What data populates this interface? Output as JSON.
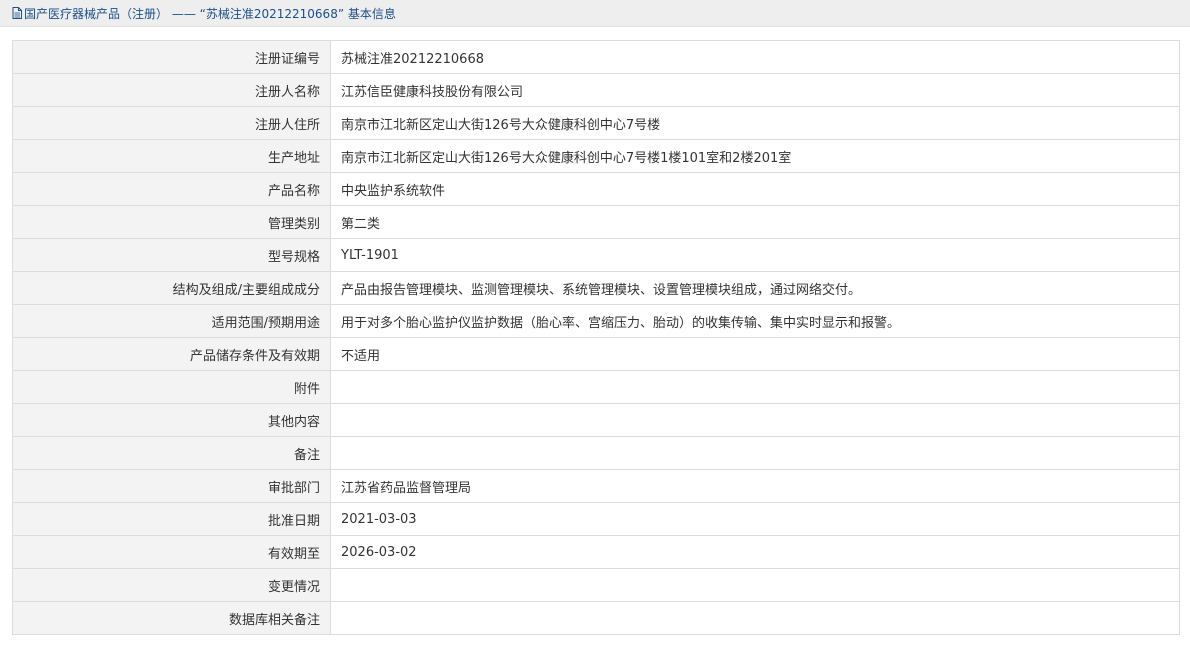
{
  "breadcrumb": {
    "text": "国产医疗器械产品（注册） —— “苏械注准20212210668” 基本信息",
    "icon": "document-icon"
  },
  "colors": {
    "breadcrumb_text": "#1a4f8a",
    "label_bg": "#f3f3f3",
    "border": "#dcdcdc"
  },
  "rows": [
    {
      "label": "注册证编号",
      "value": "苏械注准20212210668"
    },
    {
      "label": "注册人名称",
      "value": "江苏信臣健康科技股份有限公司"
    },
    {
      "label": "注册人住所",
      "value": "南京市江北新区定山大街126号大众健康科创中心7号楼"
    },
    {
      "label": "生产地址",
      "value": "南京市江北新区定山大街126号大众健康科创中心7号楼1楼101室和2楼201室"
    },
    {
      "label": "产品名称",
      "value": "中央监护系统软件"
    },
    {
      "label": "管理类别",
      "value": "第二类"
    },
    {
      "label": "型号规格",
      "value": "YLT-1901"
    },
    {
      "label": "结构及组成/主要组成成分",
      "value": "产品由报告管理模块、监测管理模块、系统管理模块、设置管理模块组成，通过网络交付。"
    },
    {
      "label": "适用范围/预期用途",
      "value": "用于对多个胎心监护仪监护数据（胎心率、宫缩压力、胎动）的收集传输、集中实时显示和报警。"
    },
    {
      "label": "产品储存条件及有效期",
      "value": "不适用"
    },
    {
      "label": "附件",
      "value": ""
    },
    {
      "label": "其他内容",
      "value": ""
    },
    {
      "label": "备注",
      "value": ""
    },
    {
      "label": "审批部门",
      "value": "江苏省药品监督管理局"
    },
    {
      "label": "批准日期",
      "value": "2021-03-03"
    },
    {
      "label": "有效期至",
      "value": "2026-03-02"
    },
    {
      "label": "变更情况",
      "value": ""
    },
    {
      "label": "数据库相关备注",
      "value": ""
    }
  ]
}
